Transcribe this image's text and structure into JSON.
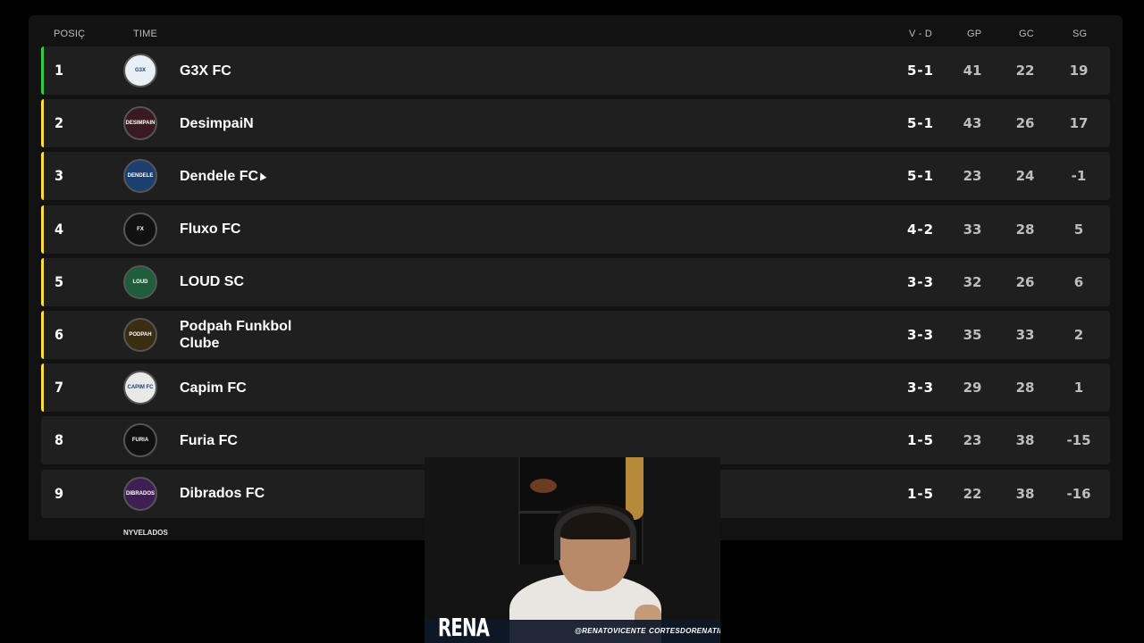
{
  "table": {
    "headers": {
      "position": "POSIÇ",
      "team": "TIME",
      "record": "V - D",
      "goals_for": "GP",
      "goals_against": "GC",
      "goal_diff": "SG"
    },
    "rows": [
      {
        "pos": "1",
        "team": "G3X FC",
        "logo_text": "G3X",
        "vd": "5-1",
        "gp": "41",
        "gc": "22",
        "sg": "19",
        "marker": "#2ecc40"
      },
      {
        "pos": "2",
        "team": "DesimpaiN",
        "logo_text": "DESIMPAIN",
        "vd": "5-1",
        "gp": "43",
        "gc": "26",
        "sg": "17",
        "marker": "#ffe135"
      },
      {
        "pos": "3",
        "team": "Dendele FC",
        "logo_text": "DENDELE",
        "vd": "5-1",
        "gp": "23",
        "gc": "24",
        "sg": "-1",
        "marker": "#ffe135"
      },
      {
        "pos": "4",
        "team": "Fluxo FC",
        "logo_text": "FX",
        "vd": "4-2",
        "gp": "33",
        "gc": "28",
        "sg": "5",
        "marker": "#ffe135"
      },
      {
        "pos": "5",
        "team": "LOUD SC",
        "logo_text": "LOUD",
        "vd": "3-3",
        "gp": "32",
        "gc": "26",
        "sg": "6",
        "marker": "#ffe135"
      },
      {
        "pos": "6",
        "team": "Podpah Funkbol Clube",
        "logo_text": "PODPAH",
        "vd": "3-3",
        "gp": "35",
        "gc": "33",
        "sg": "2",
        "marker": "#ffe135"
      },
      {
        "pos": "7",
        "team": "Capim FC",
        "logo_text": "CAPIM FC",
        "vd": "3-3",
        "gp": "29",
        "gc": "28",
        "sg": "1",
        "marker": "#ffe135"
      },
      {
        "pos": "8",
        "team": "Furia FC",
        "logo_text": "FURIA",
        "vd": "1-5",
        "gp": "23",
        "gc": "38",
        "sg": "-15",
        "marker": ""
      },
      {
        "pos": "9",
        "team": "Dibrados FC",
        "logo_text": "DIBRADOS",
        "vd": "1-5",
        "gp": "22",
        "gc": "38",
        "sg": "-16",
        "marker": ""
      }
    ],
    "partial_next_logo_text": "NYVELADOS"
  },
  "webcam": {
    "brand": "RENA",
    "handle_1": "@RENATOVICENTE",
    "handle_2": "CORTESDORENATIN"
  },
  "colors": {
    "background": "#000000",
    "panel": "#121212",
    "row": "#1f1f1f",
    "qualified_marker": "#2ecc40",
    "playoff_marker": "#ffe135"
  }
}
